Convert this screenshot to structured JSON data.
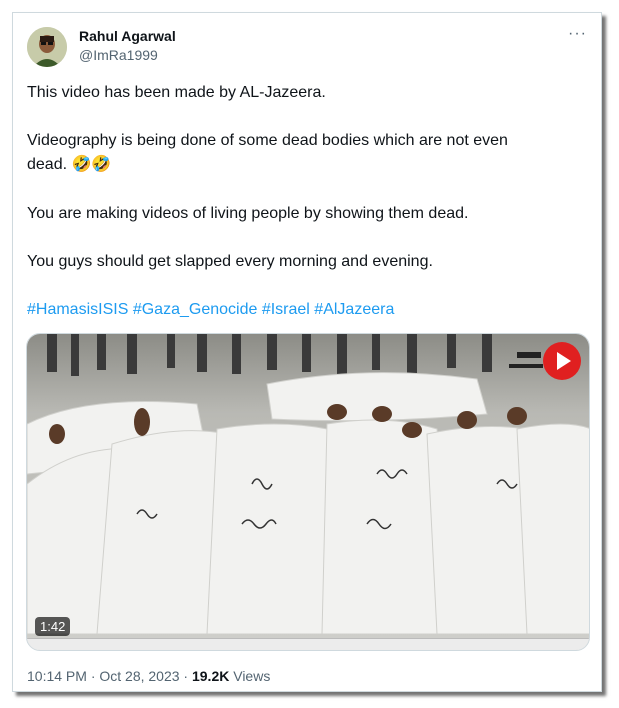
{
  "author": {
    "name": "Rahul Agarwal",
    "handle": "@ImRa1999"
  },
  "more_icon": "more-horizontal-icon",
  "tweet": {
    "line1": "This video has been made by AL-Jazeera.",
    "line2a": "Videography is being done of some dead bodies which are not even",
    "line2b": "dead. 🤣🤣",
    "line3": "You are making videos of living people by showing them dead.",
    "line4": "You guys should get slapped every morning and evening.",
    "hashtags": [
      "#HamasisISIS",
      "#Gaza_Genocide",
      "#Israel",
      "#AlJazeera"
    ]
  },
  "media": {
    "duration": "1:42"
  },
  "meta": {
    "time": "10:14 PM · Oct 28, 2023",
    "separator": "·",
    "views_count": "19.2K",
    "views_label": "Views"
  },
  "colors": {
    "link": "#1d9bf0",
    "muted": "#536471"
  }
}
